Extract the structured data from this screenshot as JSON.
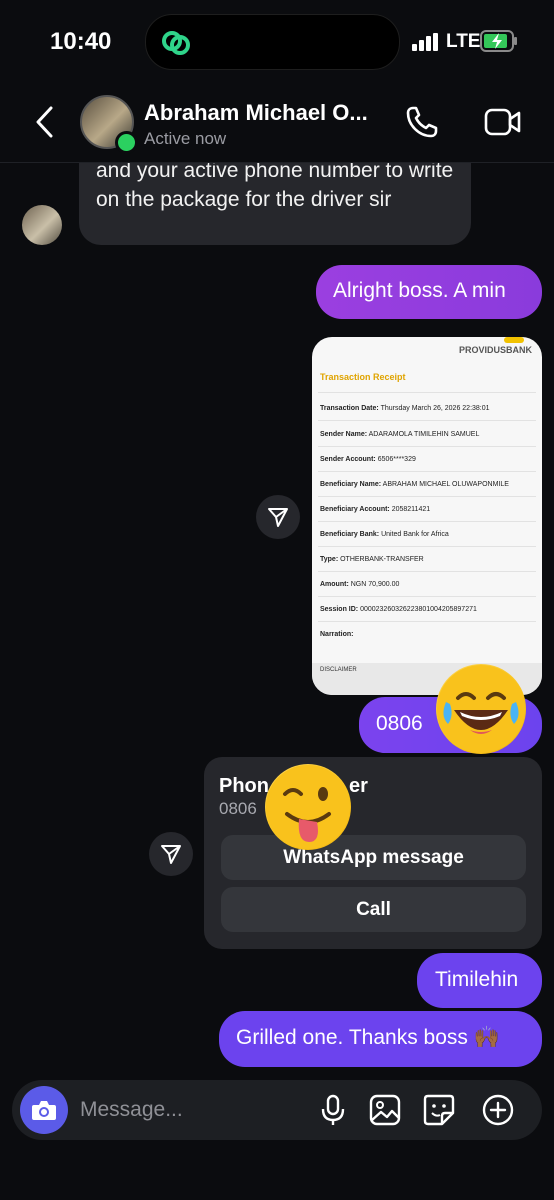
{
  "status_bar": {
    "time": "10:40",
    "network": "LTE"
  },
  "header": {
    "contact_name": "Abraham Michael O...",
    "presence": "Active now"
  },
  "messages": {
    "incoming_text": "and your active phone number to write on the package for the driver sir",
    "outgoing_1": "Alright boss. A min",
    "receipt": {
      "bank": "PROVIDUSBANK",
      "title": "Transaction Receipt",
      "rows": [
        {
          "label": "Transaction Date:",
          "value": "Thursday March 26, 2026 22:38:01"
        },
        {
          "label": "Sender Name:",
          "value": "ADARAMOLA TIMILEHIN SAMUEL"
        },
        {
          "label": "Sender Account:",
          "value": "6506****329"
        },
        {
          "label": "Beneficiary Name:",
          "value": "ABRAHAM MICHAEL OLUWAPONMILE"
        },
        {
          "label": "Beneficiary Account:",
          "value": "2058211421"
        },
        {
          "label": "Beneficiary Bank:",
          "value": "United Bank for Africa"
        },
        {
          "label": "Type:",
          "value": "OTHERBANK-TRANSFER"
        },
        {
          "label": "Amount:",
          "value": "NGN 70,900.00"
        },
        {
          "label": "Session ID:",
          "value": "000023260326223801004205897271"
        },
        {
          "label": "Narration:",
          "value": ""
        }
      ],
      "disclaimer": "DISCLAIMER"
    },
    "outgoing_phone": "0806",
    "phone_card": {
      "title_start": "Phon",
      "title_end": "er",
      "number": "0806",
      "whatsapp_label": "WhatsApp message",
      "call_label": "Call"
    },
    "outgoing_2": "Timilehin",
    "outgoing_3": "Grilled one. Thanks boss 🙌🏾"
  },
  "reactions": {
    "laughing": "laughing-tears-emoji",
    "wink": "wink-tongue-emoji"
  },
  "composer": {
    "placeholder": "Message..."
  },
  "colors": {
    "accent": "#6c43ee",
    "gradient_start": "#9b3fe0",
    "online": "#2bd160"
  }
}
